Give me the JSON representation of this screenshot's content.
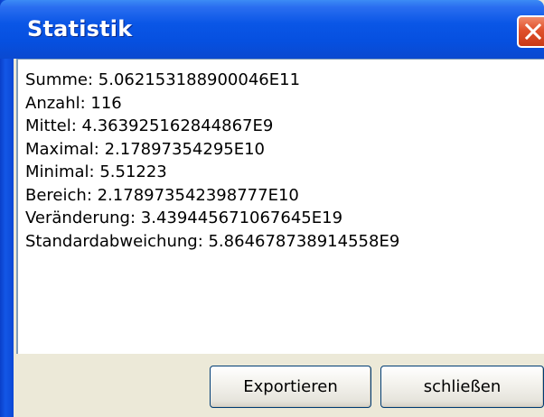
{
  "window": {
    "title": "Statistik"
  },
  "stats": [
    {
      "label": "Summe",
      "value": "5.062153188900046E11"
    },
    {
      "label": "Anzahl",
      "value": "116"
    },
    {
      "label": "Mittel",
      "value": "4.363925162844867E9"
    },
    {
      "label": "Maximal",
      "value": "2.17897354295E10"
    },
    {
      "label": "Minimal",
      "value": "5.51223"
    },
    {
      "label": "Bereich",
      "value": "2.178973542398777E10"
    },
    {
      "label": "Veränderung",
      "value": "3.439445671067645E19"
    },
    {
      "label": "Standardabweichung",
      "value": "5.864678738914558E9"
    }
  ],
  "buttons": {
    "export_label": "Exportieren",
    "close_label": "schließen"
  },
  "icons": {
    "close": "close-icon"
  },
  "colors": {
    "titlebar": "#0a56e6",
    "close_button": "#e0512c",
    "dialog_background": "#ece9d8"
  }
}
